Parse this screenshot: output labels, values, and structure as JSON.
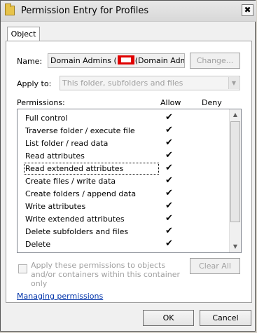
{
  "window": {
    "title": "Permission Entry for Profiles",
    "close_glyph": "✖"
  },
  "tabs": [
    {
      "label": "Object"
    }
  ],
  "name_row": {
    "label": "Name:",
    "value_before": "Domain Admins (",
    "value_after": "(Domain Admins)",
    "change_button": "Change..."
  },
  "apply_row": {
    "label": "Apply to:",
    "value": "This folder, subfolders and files"
  },
  "permissions": {
    "label": "Permissions:",
    "col_allow": "Allow",
    "col_deny": "Deny",
    "check_glyph": "✔",
    "items": [
      {
        "label": "Full control",
        "allow": true,
        "deny": false
      },
      {
        "label": "Traverse folder / execute file",
        "allow": true,
        "deny": false
      },
      {
        "label": "List folder / read data",
        "allow": true,
        "deny": false
      },
      {
        "label": "Read attributes",
        "allow": true,
        "deny": false
      },
      {
        "label": "Read extended attributes",
        "allow": true,
        "deny": false
      },
      {
        "label": "Create files / write data",
        "allow": true,
        "deny": false
      },
      {
        "label": "Create folders / append data",
        "allow": true,
        "deny": false
      },
      {
        "label": "Write attributes",
        "allow": true,
        "deny": false
      },
      {
        "label": "Write extended attributes",
        "allow": true,
        "deny": false
      },
      {
        "label": "Delete subfolders and files",
        "allow": true,
        "deny": false
      },
      {
        "label": "Delete",
        "allow": true,
        "deny": false
      }
    ]
  },
  "apply_checkbox": {
    "label": "Apply these permissions to objects and/or containers within this container only",
    "checked": false
  },
  "clear_all_button": "Clear All",
  "managing_link": "Managing permissions",
  "ok_button": "OK",
  "cancel_button": "Cancel",
  "colors": {
    "link": "#0033aa",
    "redaction": "#e00000",
    "disabled_text": "#a0a0a0"
  }
}
